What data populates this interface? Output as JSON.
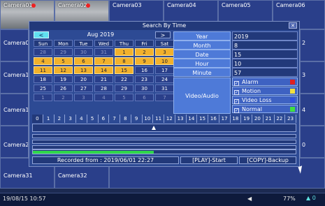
{
  "cameras": {
    "cam01": "Camera01",
    "cam02": "Camera02",
    "cam03": "Camera03",
    "cam04": "Camera04",
    "cam05": "Camera05",
    "cam06": "Camera06",
    "cam07_partial": "Camera0",
    "cam13_partial": "Camera1",
    "cam19_partial": "Camera1",
    "cam25_partial": "Camera2",
    "cam31": "Camera31",
    "cam32": "Camera32",
    "right_partial_1": "2",
    "right_partial_2": "3",
    "right_partial_3": "4",
    "right_partial_4": "0"
  },
  "status": {
    "datetime": "19/08/15 10:57",
    "volume_icon": "speaker-icon",
    "percent": "77%",
    "network_value": "0"
  },
  "dialog": {
    "title": "Search By Time",
    "close_label": "✕",
    "calendar": {
      "prev_label": "<",
      "next_label": ">",
      "month_year": "Aug 2019",
      "weekdays": [
        "Sun",
        "Mon",
        "Tue",
        "Wed",
        "Thu",
        "Fri",
        "Sat"
      ],
      "days": [
        [
          "28",
          "29",
          "30",
          "31",
          "1",
          "2",
          "3"
        ],
        [
          "4",
          "5",
          "6",
          "7",
          "8",
          "9",
          "10"
        ],
        [
          "11",
          "12",
          "13",
          "14",
          "15",
          "16",
          "17"
        ],
        [
          "18",
          "19",
          "20",
          "21",
          "22",
          "23",
          "24"
        ],
        [
          "25",
          "26",
          "27",
          "28",
          "29",
          "30",
          "31"
        ],
        [
          "1",
          "2",
          "3",
          "4",
          "5",
          "6",
          "7"
        ]
      ],
      "recorded_days": [
        "1",
        "2",
        "3",
        "4",
        "5",
        "6",
        "7",
        "8",
        "9",
        "10",
        "11",
        "12",
        "13",
        "14",
        "15"
      ]
    },
    "fields": {
      "year_label": "Year",
      "year_value": "2019",
      "month_label": "Month",
      "month_value": "8",
      "date_label": "Date",
      "date_value": "15",
      "hour_label": "Hour",
      "hour_value": "10",
      "minute_label": "Minute",
      "minute_value": "57"
    },
    "video_audio_label": "Video/Audio",
    "events": [
      {
        "label": "Alarm",
        "color": "#e02020"
      },
      {
        "label": "Motion",
        "color": "#f0e040"
      },
      {
        "label": "Video Loss",
        "color": "#3050e0"
      },
      {
        "label": "Normal",
        "color": "#40e040"
      }
    ],
    "hours": [
      "0",
      "1",
      "2",
      "3",
      "4",
      "5",
      "6",
      "7",
      "8",
      "9",
      "10",
      "11",
      "12",
      "13",
      "14",
      "15",
      "16",
      "17",
      "18",
      "19",
      "20",
      "21",
      "22",
      "23"
    ],
    "timeline_position": 0.46,
    "recorded_progress": 0.46,
    "recorded_from": "Recorded from : 2019/06/01 22:27",
    "play_label": "[PLAY]-Start",
    "copy_label": "[COPY]-Backup"
  }
}
